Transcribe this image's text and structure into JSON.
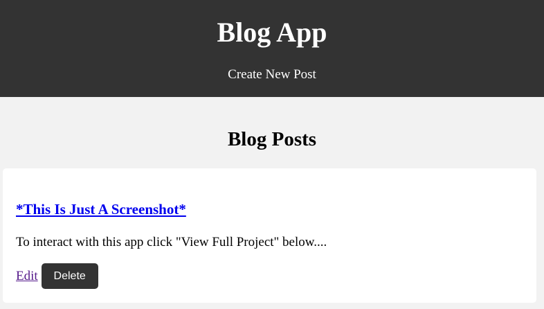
{
  "header": {
    "title": "Blog App",
    "nav_link": "Create New Post"
  },
  "main": {
    "section_title": "Blog Posts",
    "posts": [
      {
        "title": "*This Is Just A Screenshot*",
        "body": "To interact with this app click \"View Full Project\" below....",
        "edit_label": "Edit",
        "delete_label": "Delete"
      }
    ]
  },
  "colors": {
    "header_bg": "#333333",
    "page_bg": "#f2f2f2",
    "card_bg": "#ffffff",
    "link": "#0000ee",
    "visited_link": "#551a8b",
    "button_bg": "#333333"
  }
}
